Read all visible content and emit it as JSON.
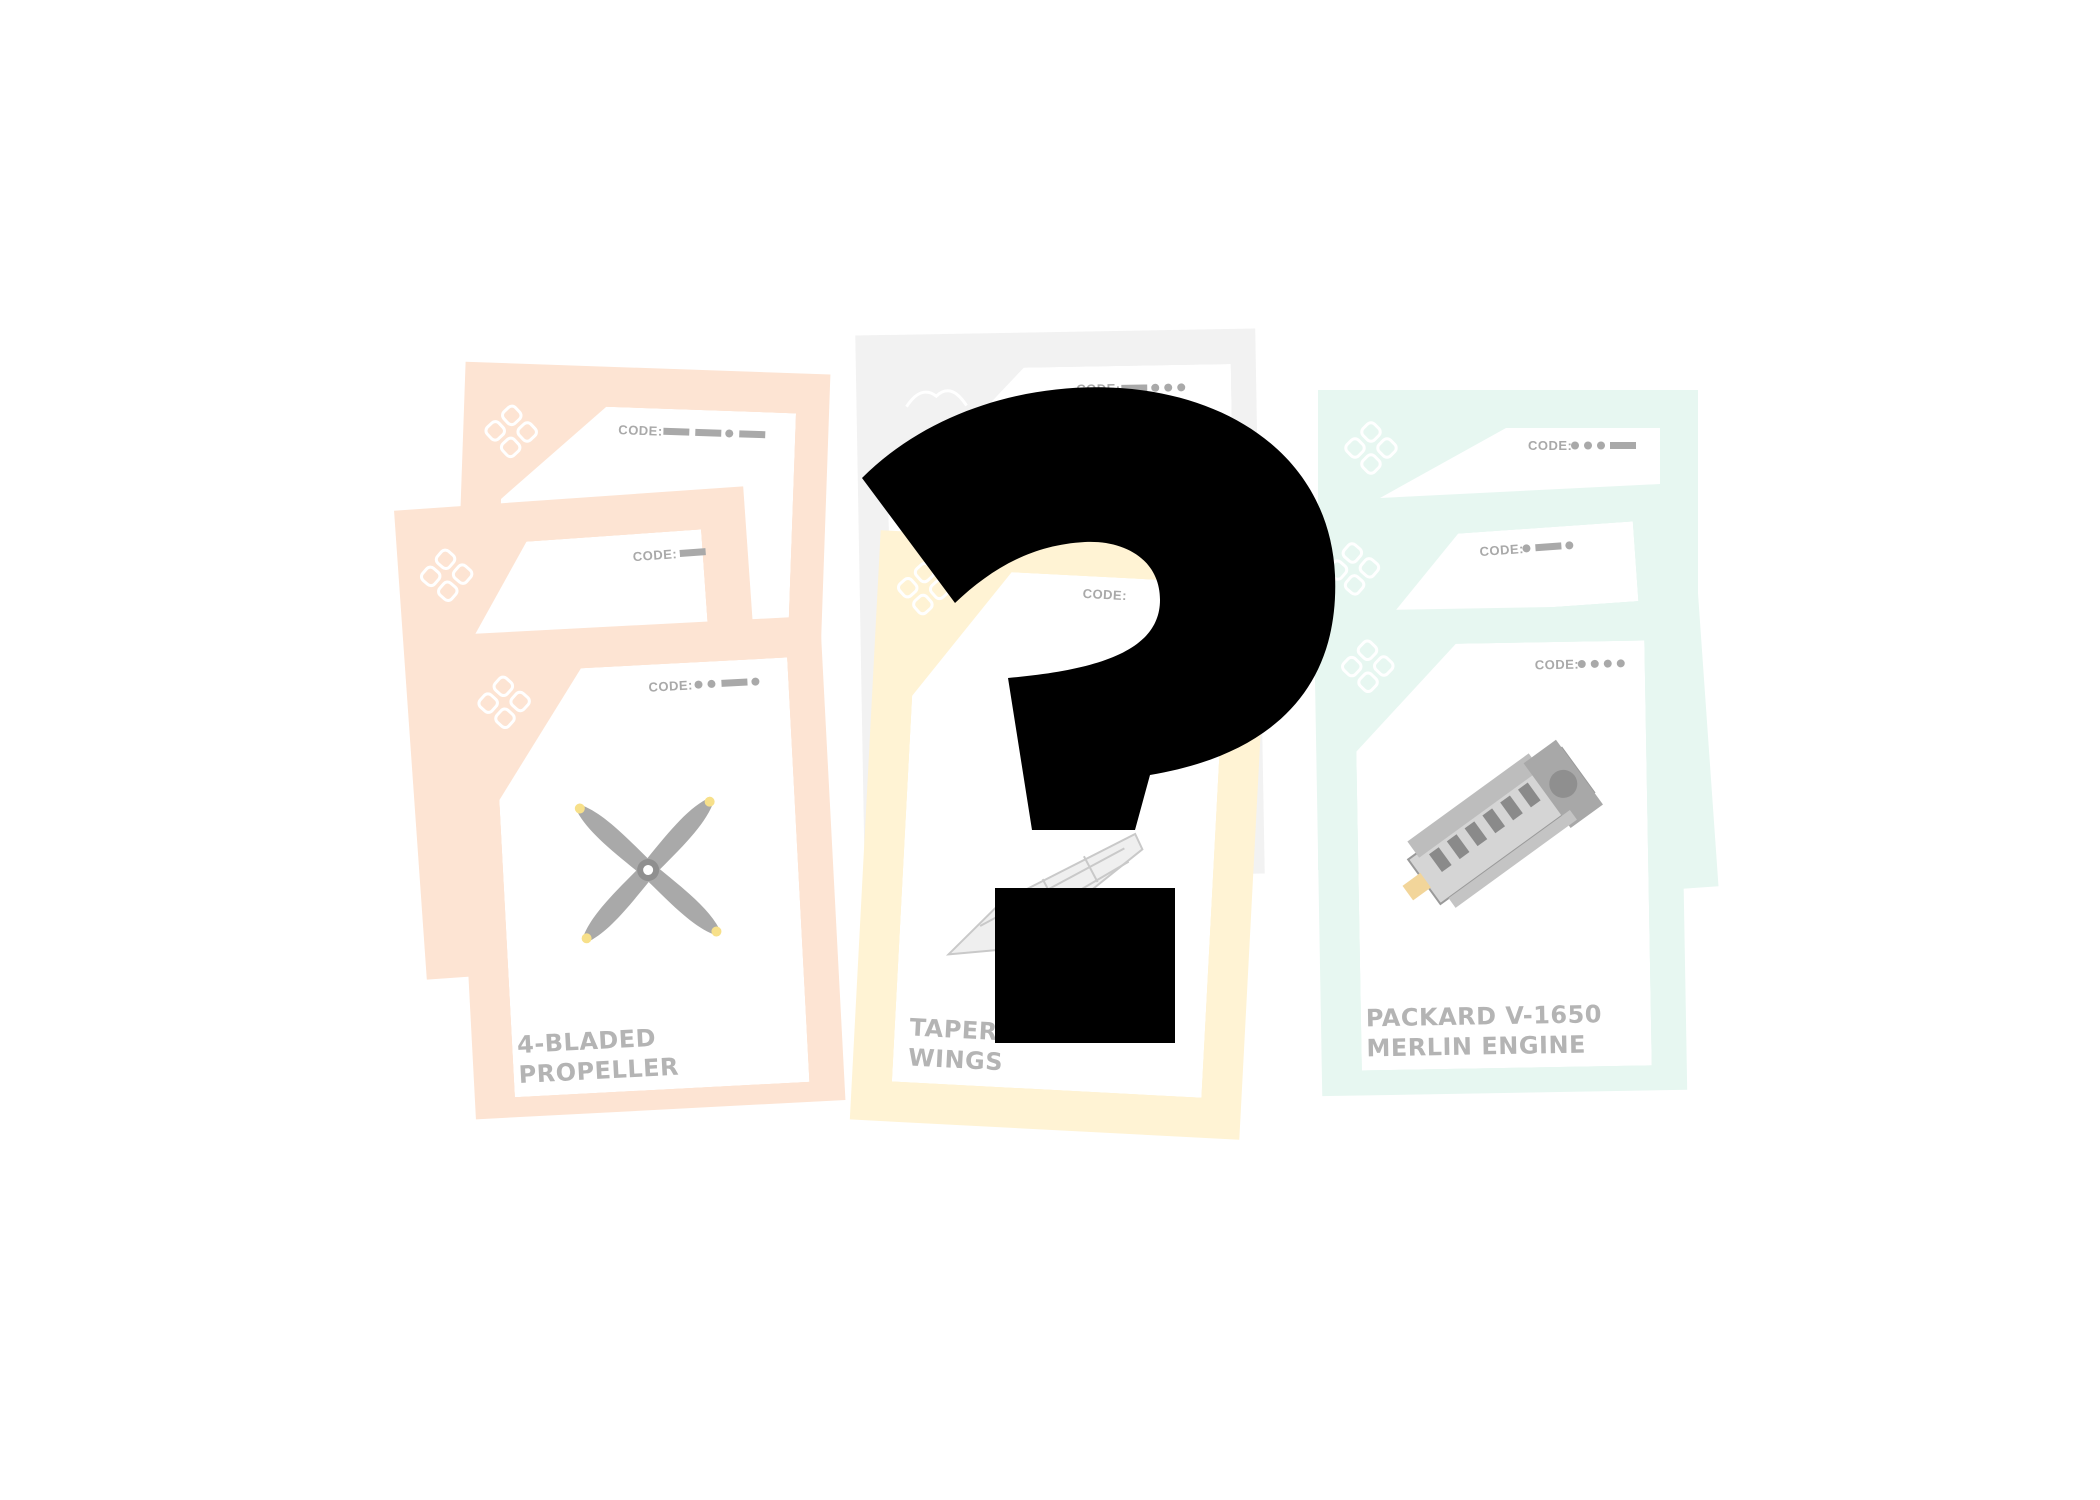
{
  "colors": {
    "orange_card": "#fde4d3",
    "yellow_card": "#fff3d4",
    "grey_card": "#f2f2f2",
    "mint_card": "#e7f7f1",
    "label_grey": "#b4b4b4",
    "question_mark": "#000000"
  },
  "cards": {
    "propeller_back1": {
      "code": "CODE:"
    },
    "propeller_back2": {
      "code": "CODE:"
    },
    "propeller_front": {
      "code": "CODE:",
      "title_line1": "4-BLADED",
      "title_line2": "PROPELLER",
      "icon": "propeller-icon"
    },
    "grey_back": {
      "code": "CODE:"
    },
    "wings_front": {
      "code": "CODE:",
      "title_line1": "TAPERED",
      "title_line2": "WINGS",
      "icon": "wing-icon"
    },
    "engine_back1": {
      "code": "CODE:"
    },
    "engine_back2": {
      "code": "CODE:"
    },
    "engine_front": {
      "code": "CODE:",
      "title_line1": "PACKARD V-1650",
      "title_line2": "MERLIN ENGINE",
      "icon": "engine-icon"
    }
  },
  "overlay": {
    "symbol": "question-mark-icon"
  }
}
